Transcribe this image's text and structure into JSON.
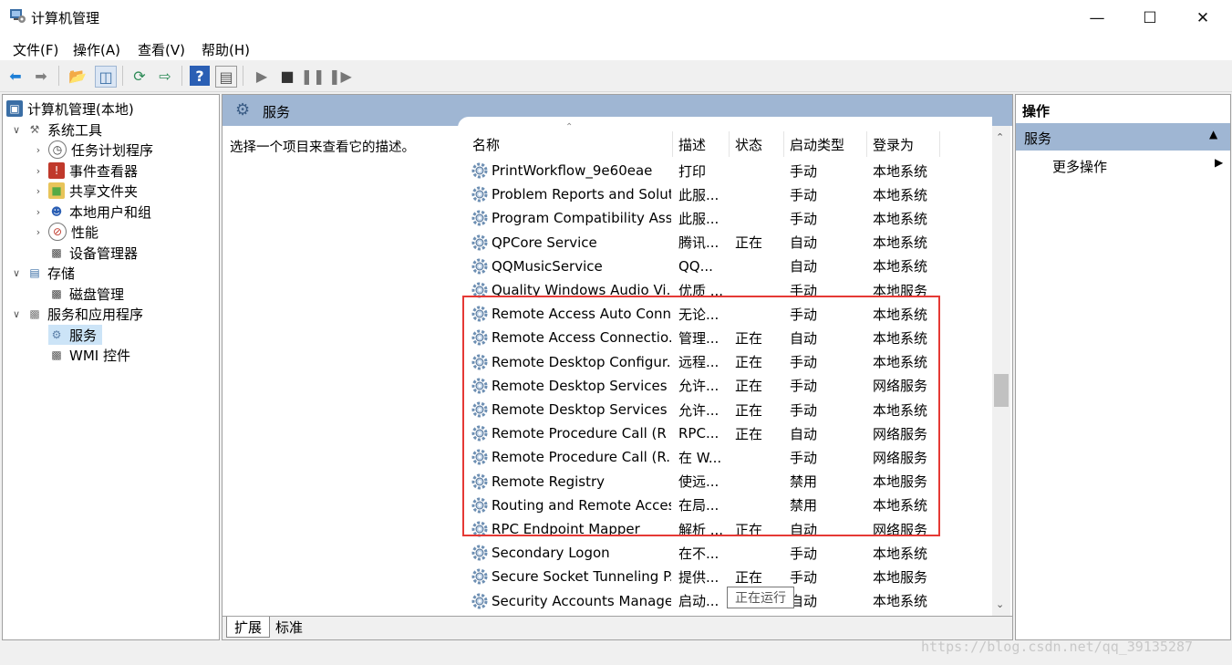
{
  "window": {
    "title": "计算机管理"
  },
  "menu": [
    "文件(F)",
    "操作(A)",
    "查看(V)",
    "帮助(H)"
  ],
  "tree": [
    {
      "label": "计算机管理(本地)",
      "icon": "computer-mgmt-icon"
    },
    {
      "label": "系统工具",
      "icon": "tools-icon"
    },
    {
      "label": "任务计划程序",
      "icon": "clock-icon"
    },
    {
      "label": "事件查看器",
      "icon": "event-viewer-icon"
    },
    {
      "label": "共享文件夹",
      "icon": "shared-folder-icon"
    },
    {
      "label": "本地用户和组",
      "icon": "users-icon"
    },
    {
      "label": "性能",
      "icon": "performance-icon"
    },
    {
      "label": "设备管理器",
      "icon": "device-manager-icon"
    },
    {
      "label": "存储",
      "icon": "storage-icon"
    },
    {
      "label": "磁盘管理",
      "icon": "disk-icon"
    },
    {
      "label": "服务和应用程序",
      "icon": "services-apps-icon"
    },
    {
      "label": "服务",
      "icon": "gear-icon"
    },
    {
      "label": "WMI 控件",
      "icon": "wmi-icon"
    }
  ],
  "center": {
    "title": "服务",
    "description": "选择一个项目来查看它的描述。",
    "columns": [
      "名称",
      "描述",
      "状态",
      "启动类型",
      "登录为"
    ],
    "rows": [
      [
        "PrintWorkflow_9e60eae",
        "打印",
        "",
        "手动",
        "本地系统"
      ],
      [
        "Problem Reports and Solut...",
        "此服...",
        "",
        "手动",
        "本地系统"
      ],
      [
        "Program Compatibility Assi...",
        "此服...",
        "",
        "手动",
        "本地系统"
      ],
      [
        "QPCore Service",
        "腾讯...",
        "正在",
        "自动",
        "本地系统"
      ],
      [
        "QQMusicService",
        "QQ...",
        "",
        "自动",
        "本地系统"
      ],
      [
        "Quality Windows Audio Vi...",
        "优质 ...",
        "",
        "手动",
        "本地服务"
      ],
      [
        "Remote Access Auto Conn...",
        "无论...",
        "",
        "手动",
        "本地系统"
      ],
      [
        "Remote Access Connectio...",
        "管理...",
        "正在",
        "自动",
        "本地系统"
      ],
      [
        "Remote Desktop Configur...",
        "远程...",
        "正在",
        "手动",
        "本地系统"
      ],
      [
        "Remote Desktop Services",
        "允许...",
        "正在",
        "手动",
        "网络服务"
      ],
      [
        "Remote Desktop Services ...",
        "允许...",
        "正在",
        "手动",
        "本地系统"
      ],
      [
        "Remote Procedure Call (R",
        "RPC...",
        "正在",
        "自动",
        "网络服务"
      ],
      [
        "Remote Procedure Call (R...",
        "在 W...",
        "",
        "手动",
        "网络服务"
      ],
      [
        "Remote Registry",
        "使远...",
        "",
        "禁用",
        "本地服务"
      ],
      [
        "Routing and Remote Access",
        "在局...",
        "",
        "禁用",
        "本地系统"
      ],
      [
        "RPC Endpoint Mapper",
        "解析 ...",
        "正在",
        "自动",
        "网络服务"
      ],
      [
        "Secondary Logon",
        "在不...",
        "",
        "手动",
        "本地系统"
      ],
      [
        "Secure Socket Tunneling P...",
        "提供...",
        "正在",
        "手动",
        "本地服务"
      ],
      [
        "Security Accounts Manager",
        "启动...",
        "",
        "自动",
        "本地系统"
      ]
    ],
    "tooltip": "正在运行",
    "tabs": [
      "扩展",
      "标准"
    ]
  },
  "actions": {
    "title": "操作",
    "section": "服务",
    "more": "更多操作"
  },
  "watermark": "https://blog.csdn.net/qq_39135287",
  "colors": {
    "header_blue": "#9fb6d3",
    "highlight_red": "#e53935"
  }
}
